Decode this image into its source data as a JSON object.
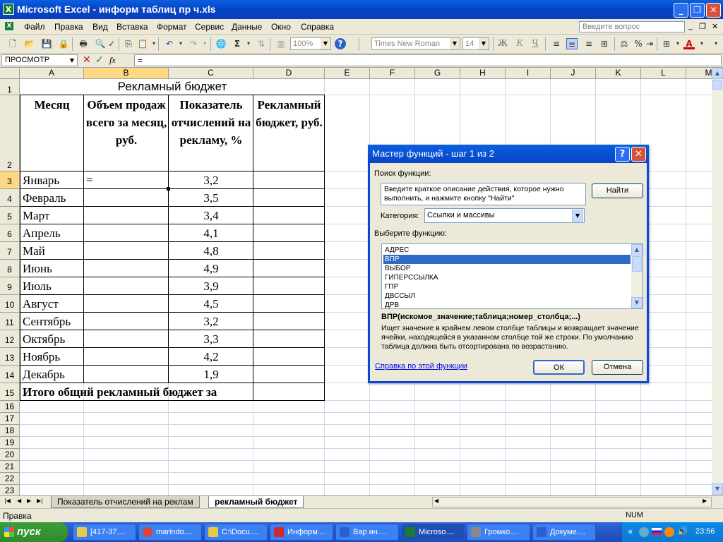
{
  "window": {
    "title": "Microsoft Excel - информ таблиц пр ч.xls",
    "logo": "X",
    "btn_min": "_",
    "btn_max": "❐",
    "btn_close": "✕"
  },
  "menu": {
    "items": [
      "Файл",
      "Правка",
      "Вид",
      "Вставка",
      "Формат",
      "Сервис",
      "Данные",
      "Окно",
      "Справка"
    ],
    "help_placeholder": "Введите вопрос",
    "doc_min": "_",
    "doc_restore": "❐",
    "doc_close": "✕"
  },
  "toolbar": {
    "zoom": "100%",
    "font": "Times New Roman",
    "size": "14",
    "bold": "Ж",
    "italic": "К",
    "underline": "Ч",
    "font_color_label": "А",
    "sum": "Σ",
    "help": "?"
  },
  "formula_bar": {
    "name_box": "ПРОСМОТР",
    "cancel": "✕",
    "enter": "✓",
    "fx": "fx",
    "content": "="
  },
  "grid": {
    "columns": [
      "A",
      "B",
      "C",
      "D",
      "E",
      "F",
      "G",
      "H",
      "I",
      "J",
      "K",
      "L",
      "M"
    ],
    "rows": [
      "1",
      "2",
      "3",
      "4",
      "5",
      "6",
      "7",
      "8",
      "9",
      "10",
      "11",
      "12",
      "13",
      "14",
      "15",
      "16",
      "17",
      "18",
      "19",
      "20",
      "21",
      "22",
      "23"
    ],
    "title": "Рекламный бюджет",
    "headers": [
      "Месяц",
      "Объем продаж всего за месяц, руб.",
      "Показатель отчислений на рекламу, %",
      "Рекламный бюджет, руб."
    ],
    "months": [
      "Январь",
      "Февраль",
      "Март",
      "Апрель",
      "Май",
      "Июнь",
      "Июль",
      "Август",
      "Сентябрь",
      "Октябрь",
      "Ноябрь",
      "Декабрь"
    ],
    "rates": [
      "3,2",
      "3,5",
      "3,4",
      "4,1",
      "4,8",
      "4,9",
      "3,9",
      "4,5",
      "3,2",
      "3,3",
      "4,2",
      "1,9"
    ],
    "active_cell_value": "=",
    "total_label": "Итого общий рекламный бюджет за"
  },
  "dialog": {
    "title": "Мастер функций - шаг 1 из 2",
    "help_btn": "?",
    "close_btn": "✕",
    "search_label": "Поиск функции:",
    "search_text": "Введите краткое описание действия, которое нужно выполнить, и нажмите кнопку \"Найти\"",
    "find_button": "Найти",
    "category_label": "Категория:",
    "category_value": "Ссылки и массивы",
    "select_label": "Выберите функцию:",
    "functions": [
      "АДРЕС",
      "ВПР",
      "ВЫБОР",
      "ГИПЕРССЫЛКА",
      "ГПР",
      "ДВССЫЛ",
      "ДРВ"
    ],
    "selected_index": 1,
    "signature": "ВПР(искомое_значение;таблица;номер_столбца;...)",
    "description": "Ищет значение в крайнем левом столбце таблицы и возвращает значение ячейки, находящейся в указанном столбце той же строки. По умолчанию таблица должна быть отсортирована по возрастанию.",
    "help_link": "Справка по этой функции",
    "ok": "ОК",
    "cancel": "Отмена"
  },
  "sheets": {
    "tabs": [
      "Показатель отчислений на реклам",
      "рекламный бюджет"
    ],
    "active": 1
  },
  "status": {
    "left": "Правка",
    "num": "NUM"
  },
  "taskbar": {
    "start": "пуск",
    "items": [
      {
        "label": "[417-37....",
        "color": "#e8c94a"
      },
      {
        "label": "marindo....",
        "color": "#d9433a"
      },
      {
        "label": "C:\\Docu....",
        "color": "#e8c94a"
      },
      {
        "label": "Информ....",
        "color": "#d02b2b"
      },
      {
        "label": "Вар ин....",
        "color": "#2b5fc9"
      },
      {
        "label": "Microso....",
        "color": "#1d7a32"
      },
      {
        "label": "Громко....",
        "color": "#888888"
      },
      {
        "label": "Докуме....",
        "color": "#2b5fc9"
      }
    ],
    "clock": "23:56"
  }
}
